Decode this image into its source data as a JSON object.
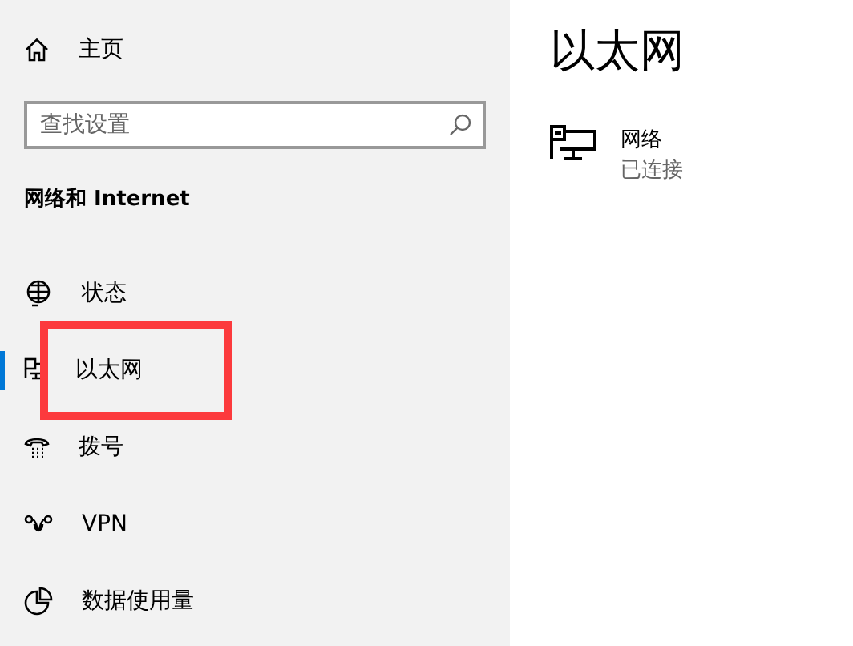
{
  "sidebar": {
    "home": {
      "label": "主页"
    },
    "search": {
      "placeholder": "查找设置"
    },
    "section_title": "网络和 Internet",
    "items": [
      {
        "label": "状态",
        "kind": "globe",
        "selected": false,
        "highlighted": false
      },
      {
        "label": "以太网",
        "kind": "ethernet",
        "selected": true,
        "highlighted": true
      },
      {
        "label": "拨号",
        "kind": "phone",
        "selected": false,
        "highlighted": false
      },
      {
        "label": "VPN",
        "kind": "vpn",
        "selected": false,
        "highlighted": false
      },
      {
        "label": "数据使用量",
        "kind": "pie",
        "selected": false,
        "highlighted": false
      }
    ]
  },
  "content": {
    "title": "以太网",
    "network": {
      "name": "网络",
      "status": "已连接"
    }
  }
}
